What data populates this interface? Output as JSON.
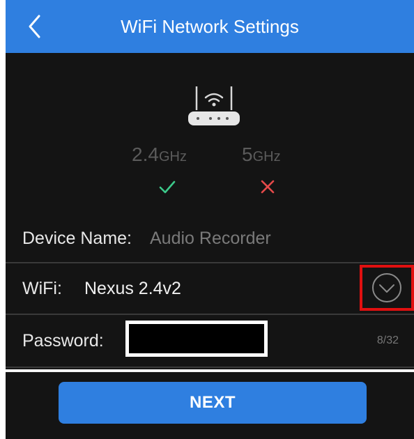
{
  "header": {
    "back_icon": "chevron-left-icon",
    "title": "WiFi Network Settings"
  },
  "router": {
    "icon": "wifi-router-icon"
  },
  "bands": [
    {
      "value": "2.4",
      "unit": "GHz",
      "status": "check-icon",
      "status_color": "#3cc98a"
    },
    {
      "value": "5",
      "unit": "GHz",
      "status": "cross-icon",
      "status_color": "#e64a4a"
    }
  ],
  "form": {
    "device_name": {
      "label": "Device Name:",
      "value": "Audio Recorder"
    },
    "wifi": {
      "label": "WiFi:",
      "value": "Nexus 2.4v2",
      "dropdown_icon": "chevron-down-circle-icon"
    },
    "password": {
      "label": "Password:",
      "counter": "8/32"
    }
  },
  "next_label": "NEXT",
  "colors": {
    "accent": "#2f7fe0",
    "background": "#141414",
    "highlight": "#e01010"
  }
}
